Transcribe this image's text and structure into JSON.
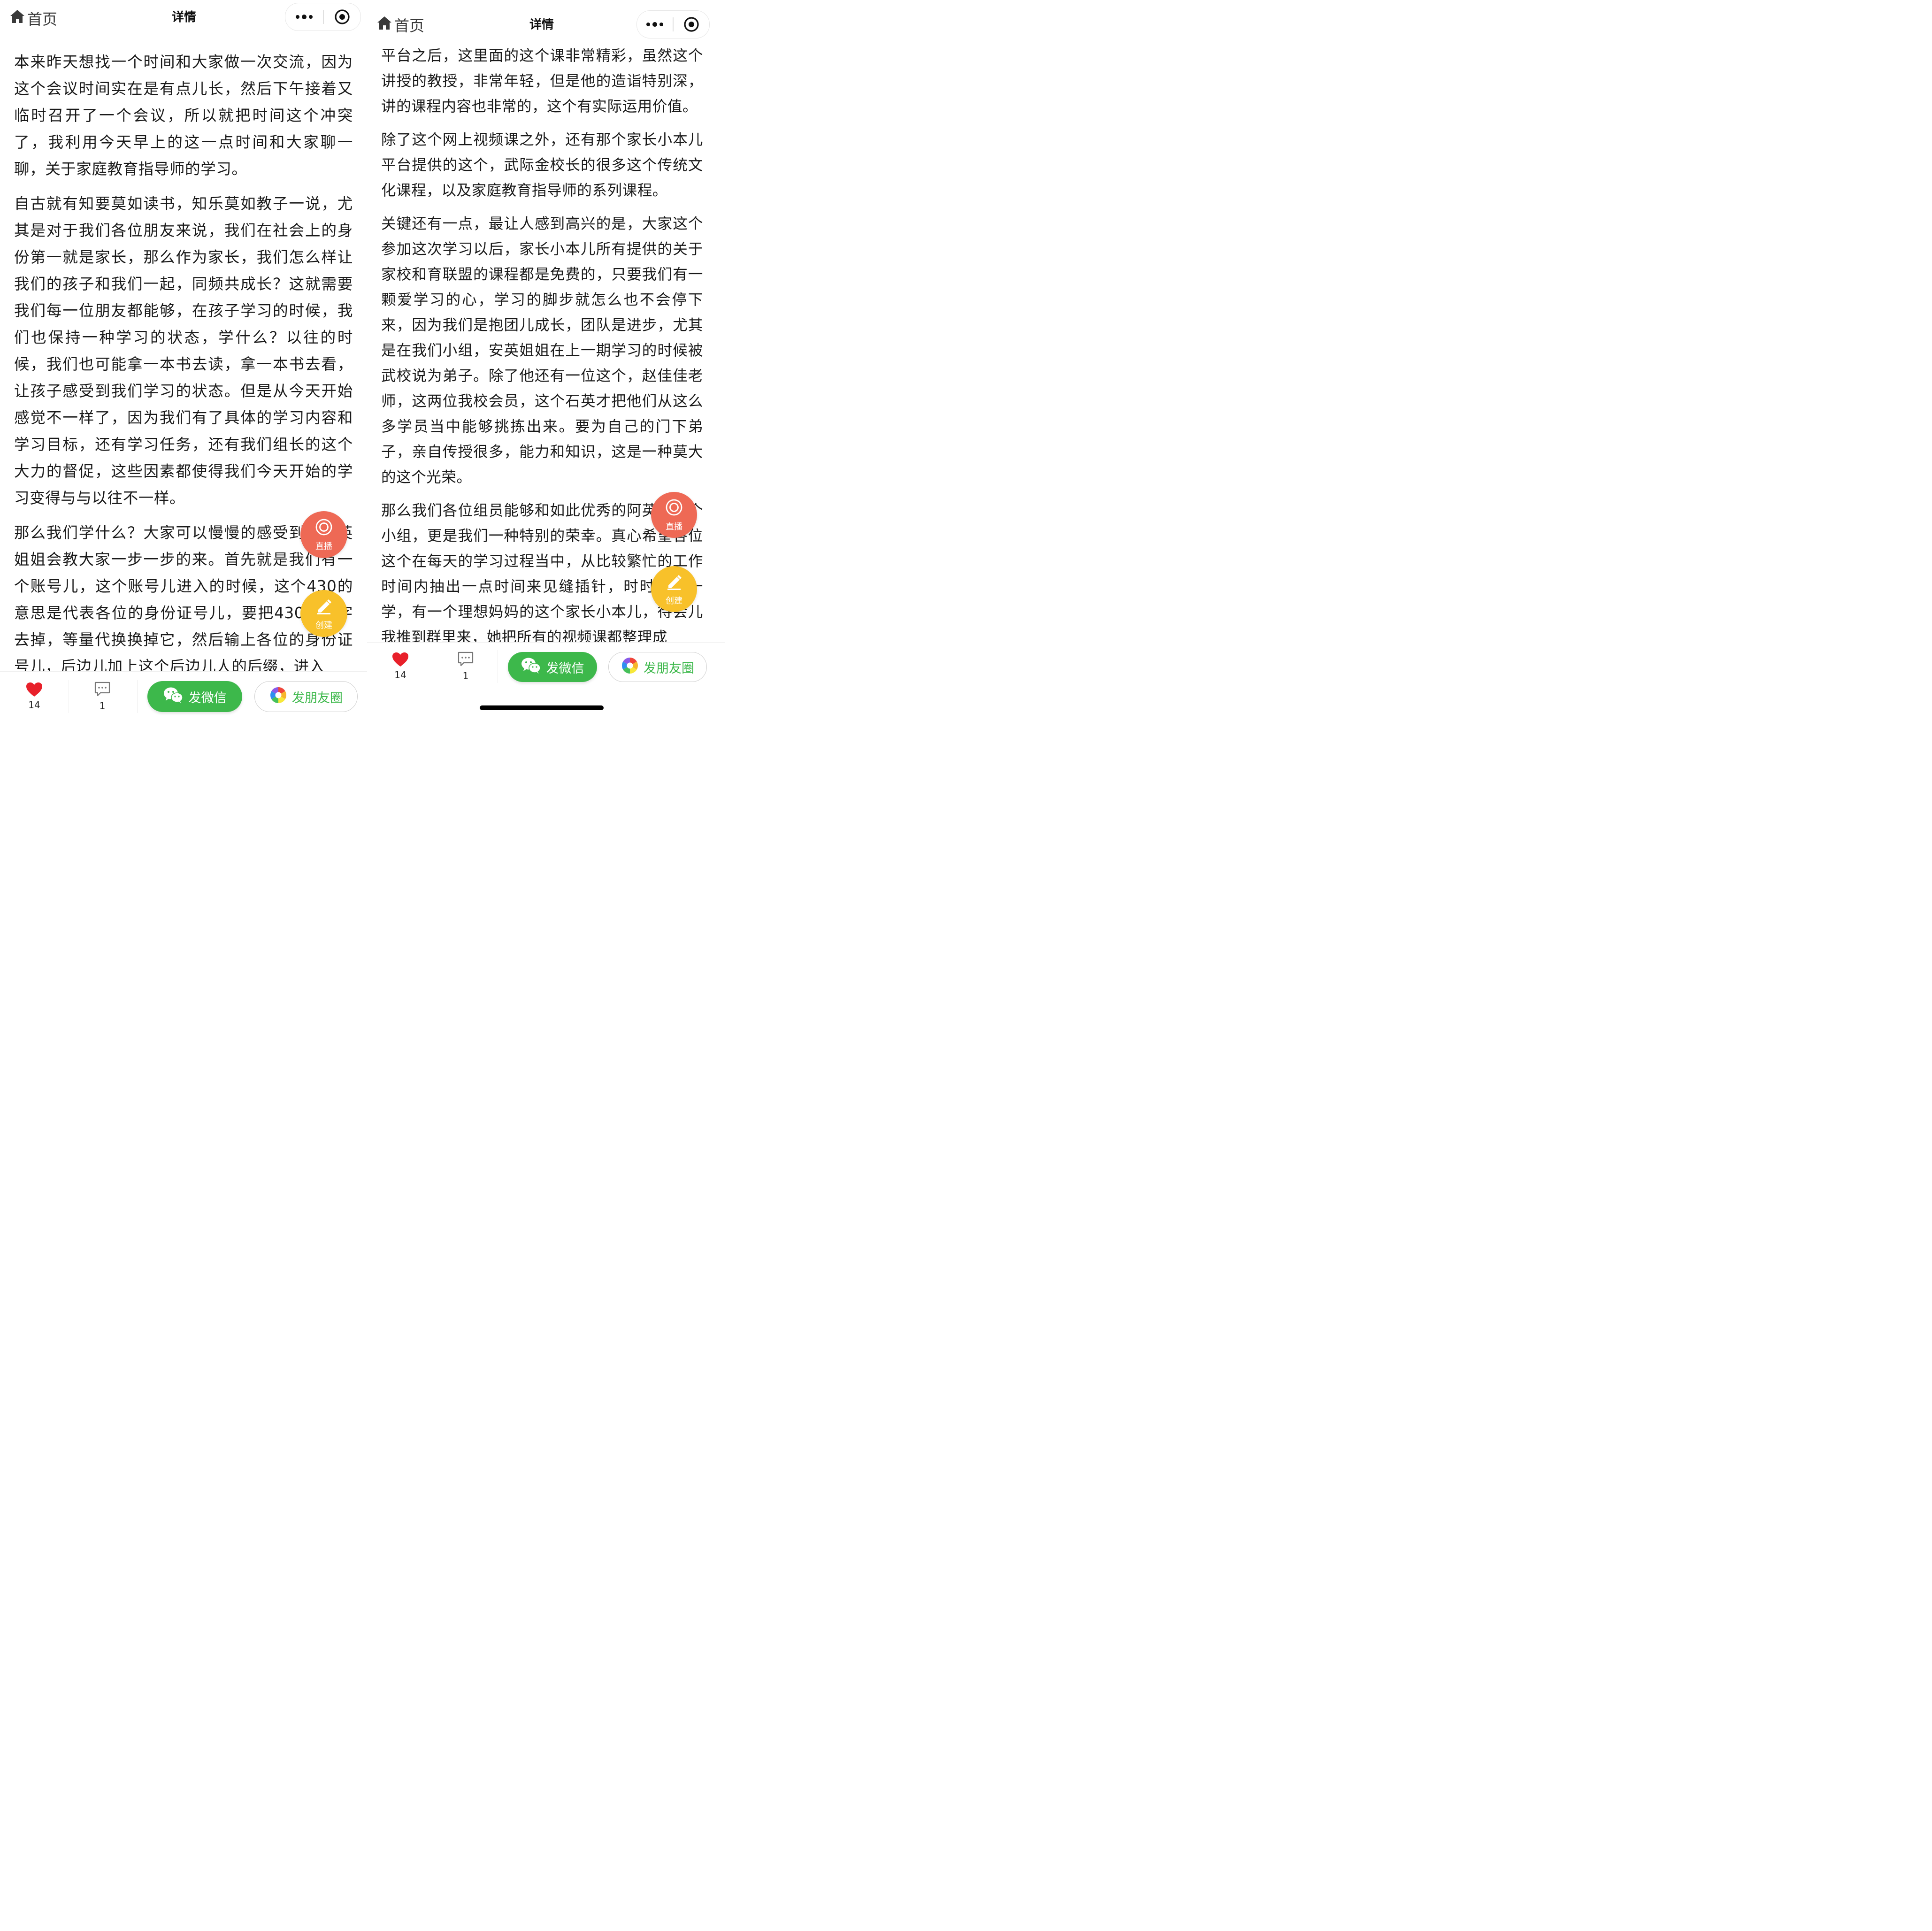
{
  "nav": {
    "home_label": "首页",
    "title": "详情"
  },
  "left": {
    "paragraphs": [
      "本来昨天想找一个时间和大家做一次交流，因为这个会议时间实在是有点儿长，然后下午接着又临时召开了一个会议，所以就把时间这个冲突了，我利用今天早上的这一点时间和大家聊一聊，关于家庭教育指导师的学习。",
      "自古就有知要莫如读书，知乐莫如教子一说，尤其是对于我们各位朋友来说，我们在社会上的身份第一就是家长，那么作为家长，我们怎么样让我们的孩子和我们一起，同频共成长？这就需要我们每一位朋友都能够，在孩子学习的时候，我们也保持一种学习的状态，学什么？以往的时候，我们也可能拿一本书去读，拿一本书去看，让孩子感受到我们学习的状态。但是从今天开始感觉不一样了，因为我们有了具体的学习内容和学习目标，还有学习任务，还有我们组长的这个大力的督促，这些因素都使得我们今天开始的学习变得与与以往不一样。",
      "那么我们学什么？大家可以慢慢的感受到，安英姐姐会教大家一步一步的来。首先就是我们有一个账号儿，这个账号儿进入的时候，这个430的意思是代表各位的身份证号儿，要把430的数字去掉，等量代换换掉它，然后输上各位的身份证号儿，后边儿加上这个后边儿人的后缀，进入"
    ]
  },
  "right": {
    "paragraphs": [
      "平台之后，这里面的这个课非常精彩，虽然这个讲授的教授，非常年轻，但是他的造诣特别深，讲的课程内容也非常的，这个有实际运用价值。",
      "除了这个网上视频课之外，还有那个家长小本儿平台提供的这个，武际金校长的很多这个传统文化课程，以及家庭教育指导师的系列课程。",
      "关键还有一点，最让人感到高兴的是，大家这个参加这次学习以后，家长小本儿所有提供的关于家校和育联盟的课程都是免费的，只要我们有一颗爱学习的心，学习的脚步就怎么也不会停下来，因为我们是抱团儿成长，团队是进步，尤其是在我们小组，安英姐姐在上一期学习的时候被武校说为弟子。除了他还有一位这个，赵佳佳老师，这两位我校会员，这个石英才把他们从这么多学员当中能够挑拣出来。要为自己的门下弟子，亲自传授很多，能力和知识，这是一种莫大的这个光荣。",
      "那么我们各位组员能够和如此优秀的阿英在一个小组，更是我们一种特别的荣幸。真心希望各位这个在每天的学习过程当中，从比较繁忙的工作时间内抽出一点时间来见缝插针，时时的学一学，有一个理想妈妈的这个家长小本儿，待会儿我推到群里来，她把所有的视频课都整理成"
    ]
  },
  "fab": {
    "live_label": "直播",
    "create_label": "创建"
  },
  "bottom": {
    "like_count": "14",
    "comment_count": "1",
    "wechat_label": "发微信",
    "moments_label": "发朋友圈"
  },
  "icons": {
    "home": "home-icon",
    "more": "more-dots-icon",
    "close": "target-close-icon",
    "heart": "heart-icon",
    "comment": "comment-icon",
    "live": "live-target-icon",
    "create": "pencil-icon",
    "wechat": "wechat-icon",
    "moments": "moments-aperture-icon"
  },
  "colors": {
    "wechat_green": "#3db84b",
    "heart_red": "#e8202a",
    "live_fab": "#ee6955",
    "create_fab": "#f8c12a"
  }
}
